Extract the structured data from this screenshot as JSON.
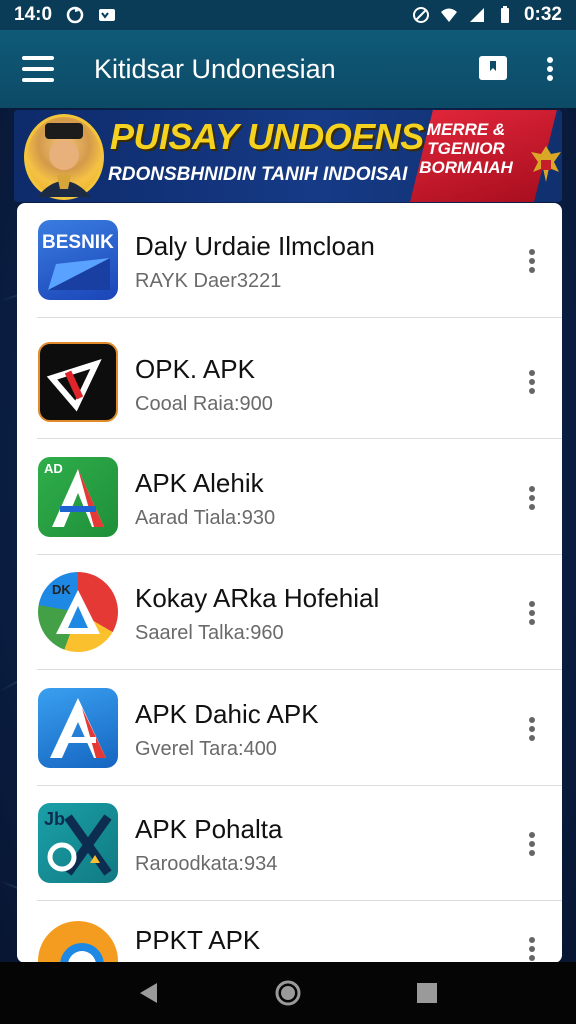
{
  "status_bar": {
    "time": "14:0",
    "right_time": "0:32"
  },
  "app_bar": {
    "title": "Kitidsar Undonesian"
  },
  "banner": {
    "title": "PUISAY UNDOENSIA",
    "subtitle": "RDONSBHNIDIN TANIH INDOISAI",
    "badge_text": "MERRE & TGENIOR BORMAIAH"
  },
  "apps": [
    {
      "title": "Daly Urdaie Ilmcloan",
      "subtitle": "RAYK Daer3221",
      "icon": "besnik-icon",
      "icon_text": "BESNIK"
    },
    {
      "title": "OPK. APK",
      "subtitle": "Cooal Raia:900",
      "icon": "opk-icon"
    },
    {
      "title": "APK Alehik",
      "subtitle": "Aarad Tiala:930",
      "icon": "apk-alehik-icon",
      "icon_text": "AD"
    },
    {
      "title": "Kokay ARka Hofehial",
      "subtitle": "Saarel Talka:960",
      "icon": "kokay-icon",
      "icon_text": "DK"
    },
    {
      "title": "APK Dahic APK",
      "subtitle": "Gverel Tara:400",
      "icon": "apk-dahic-icon"
    },
    {
      "title": "APK Pohalta",
      "subtitle": "Raroodkata:934",
      "icon": "apk-pohalta-icon",
      "icon_text": "Jb"
    },
    {
      "title": "PPKT APK",
      "subtitle": "",
      "icon": "ppkt-icon"
    }
  ],
  "icons": {
    "status": [
      "android-icon",
      "sync-icon",
      "notification-icon",
      "do-not-disturb-icon",
      "wifi-icon",
      "signal-icon",
      "battery-icon"
    ],
    "app_bar": [
      "menu-icon",
      "bookmark-icon",
      "more-vert-icon"
    ],
    "nav": [
      "back-icon",
      "home-icon",
      "recents-icon"
    ]
  },
  "colors": {
    "app_bar": "#0c4a66",
    "banner_title": "#f4d21f",
    "badge": "#e0253a",
    "nav": "#050505"
  }
}
